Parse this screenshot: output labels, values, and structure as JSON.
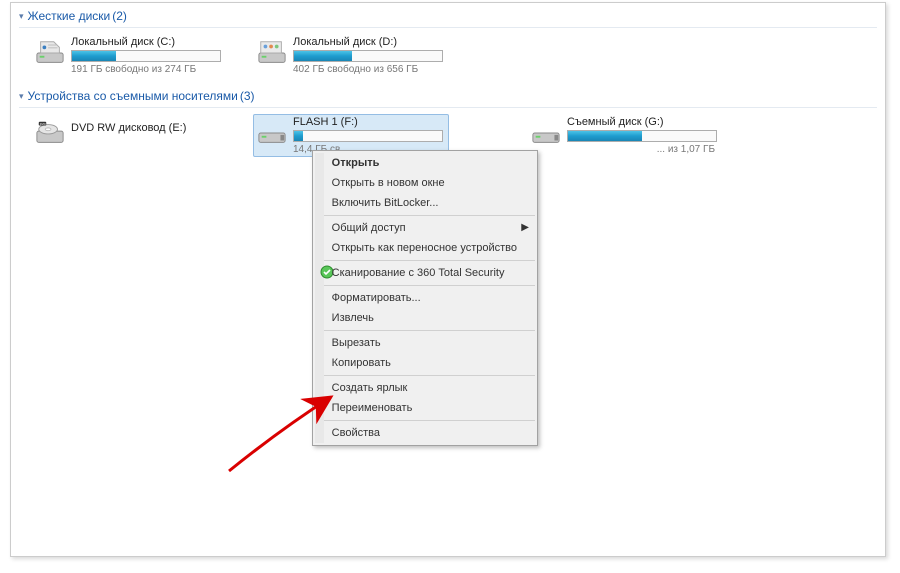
{
  "sections": {
    "hard_drives": {
      "title": "Жесткие диски",
      "count": "(2)"
    },
    "removable": {
      "title": "Устройства со съемными носителями",
      "count": "(3)"
    }
  },
  "drives": {
    "c": {
      "label": "Локальный диск (C:)",
      "status": "191 ГБ свободно из 274 ГБ",
      "fill_pct": 30,
      "fill_color": "normal"
    },
    "d": {
      "label": "Локальный диск (D:)",
      "status": "402 ГБ свободно из 656 ГБ",
      "fill_pct": 39,
      "fill_color": "normal"
    },
    "dvd": {
      "label": "DVD RW дисковод (E:)",
      "status": "",
      "fill_pct": 0
    },
    "flash": {
      "label": "FLASH 1 (F:)",
      "status": "14,4 ГБ св...",
      "fill_pct": 6,
      "fill_color": "normal"
    },
    "g": {
      "label": "Съемный диск (G:)",
      "status": "... из 1,07 ГБ",
      "fill_pct": 50,
      "fill_color": "normal"
    }
  },
  "context_menu": {
    "open": "Открыть",
    "open_new_window": "Открыть в новом окне",
    "bitlocker": "Включить BitLocker...",
    "share": "Общий доступ",
    "open_portable": "Открыть как переносное устройство",
    "scan360": "Сканирование с 360 Total Security",
    "format": "Форматировать...",
    "eject": "Извлечь",
    "cut": "Вырезать",
    "copy": "Копировать",
    "create_shortcut": "Создать ярлык",
    "rename": "Переименовать",
    "properties": "Свойства"
  }
}
